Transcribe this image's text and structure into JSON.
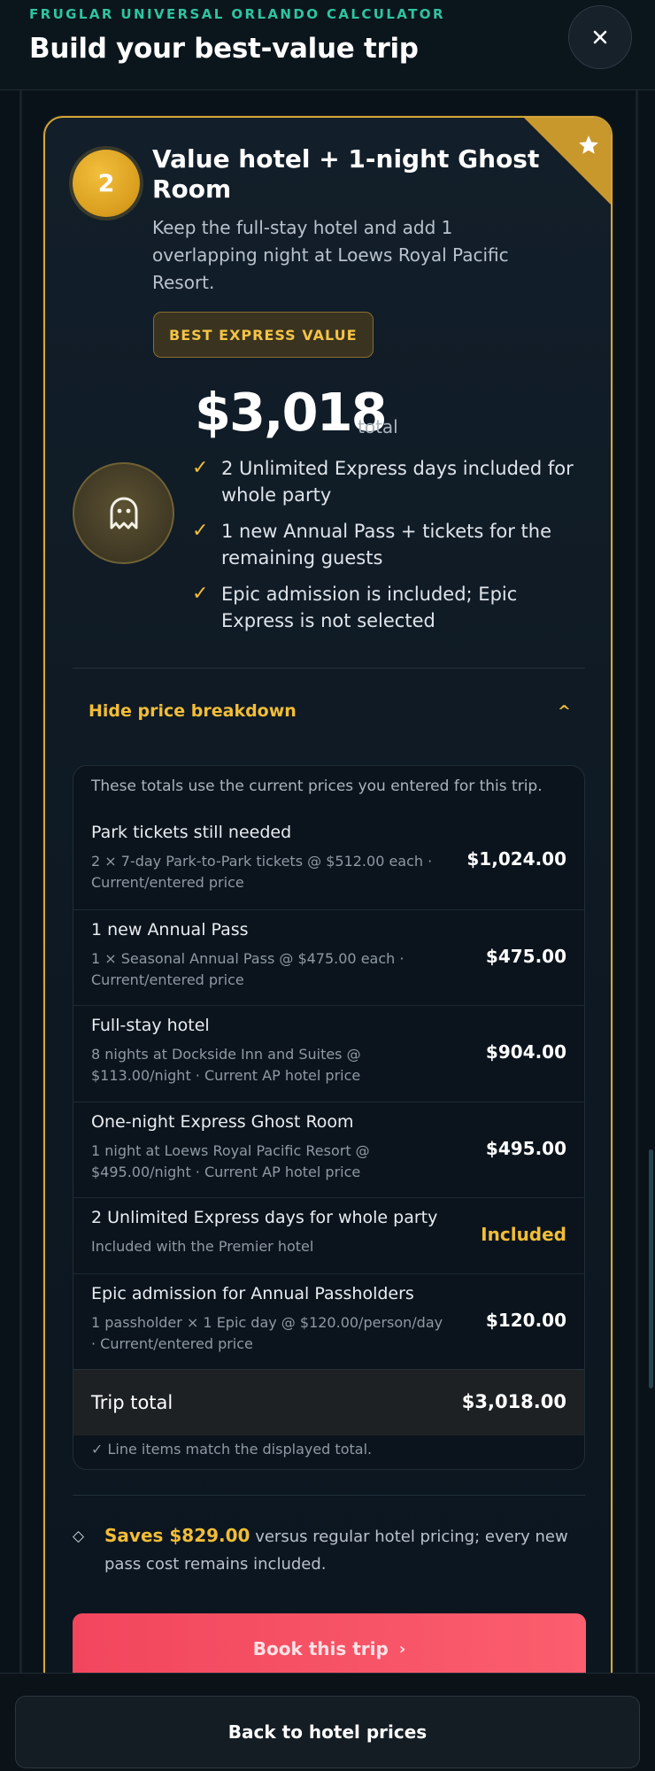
{
  "header": {
    "eyebrow": "FRUGLAR UNIVERSAL ORLANDO CALCULATOR",
    "title": "Build your best-value trip",
    "close_label": "×"
  },
  "option": {
    "step_number": "2",
    "title": "Value hotel + 1-night Ghost Room",
    "description": "Keep the full-stay hotel and add 1 overlapping night at Loews Royal Pacific Resort.",
    "badge": "BEST EXPRESS VALUE",
    "price": "$3,018",
    "price_suffix": "total",
    "highlights": [
      "2 Unlimited Express days included for whole party",
      "1 new Annual Pass + tickets for the remaining guests",
      "Epic admission is included; Epic Express is not selected"
    ],
    "check_glyph": "✓",
    "icons": {
      "corner": "star-icon",
      "medal": "ghost-icon"
    }
  },
  "breakdown": {
    "toggle_label": "Hide price breakdown",
    "toggle_caret": "^",
    "note": "These totals use the current prices you entered for this trip.",
    "items": [
      {
        "title": "Park tickets still needed",
        "detail": "2 × 7-day Park-to-Park tickets @ $512.00 each · Current/entered price",
        "amount": "$1,024.00"
      },
      {
        "title": "1 new Annual Pass",
        "detail": "1 × Seasonal Annual Pass @ $475.00 each · Current/entered price",
        "amount": "$475.00"
      },
      {
        "title": "Full-stay hotel",
        "detail": "8 nights at Dockside Inn and Suites @ $113.00/night · Current AP hotel price",
        "amount": "$904.00"
      },
      {
        "title": "One-night Express Ghost Room",
        "detail": "1 night at Loews Royal Pacific Resort @ $495.00/night · Current AP hotel price",
        "amount": "$495.00"
      },
      {
        "title": "2 Unlimited Express days for whole party",
        "detail": "Included with the Premier hotel",
        "amount": "Included"
      },
      {
        "title": "Epic admission for Annual Passholders",
        "detail": "1 passholder × 1 Epic day @ $120.00/person/day · Current/entered price",
        "amount": "$120.00"
      }
    ],
    "total_label": "Trip total",
    "total_amount": "$3,018.00",
    "match_note": "✓ Line items match the displayed total."
  },
  "savings": {
    "glyph": "◇",
    "amount_text": "Saves $829.00",
    "rest_text": " versus regular hotel pricing; every new pass cost remains included."
  },
  "actions": {
    "book_label": "Book this trip",
    "book_chevron": "›",
    "back_label": "Back to hotel prices"
  },
  "colors": {
    "accent_gold": "#f2bd36",
    "accent_teal": "#2ec4a0",
    "cta_red": "#f2465d",
    "background": "#0a1219"
  }
}
